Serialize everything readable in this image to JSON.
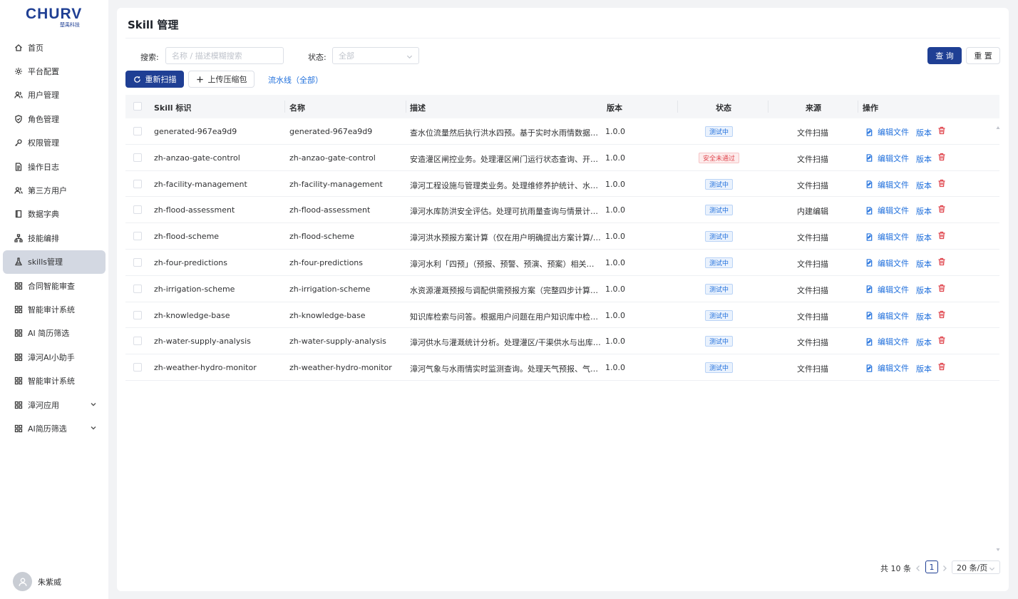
{
  "brand": {
    "logo_text": "CHURV",
    "logo_sub": "楚禹科技"
  },
  "sidebar": {
    "items": [
      {
        "label": "首页",
        "icon": "home-icon"
      },
      {
        "label": "平台配置",
        "icon": "gear-icon"
      },
      {
        "label": "用户管理",
        "icon": "users-icon"
      },
      {
        "label": "角色管理",
        "icon": "shield-icon"
      },
      {
        "label": "权限管理",
        "icon": "key-icon"
      },
      {
        "label": "操作日志",
        "icon": "document-icon"
      },
      {
        "label": "第三方用户",
        "icon": "users-icon"
      },
      {
        "label": "数据字典",
        "icon": "book-icon"
      },
      {
        "label": "技能编排",
        "icon": "flow-icon"
      },
      {
        "label": "skills管理",
        "icon": "flask-icon",
        "active": true
      },
      {
        "label": "合同智能审查",
        "icon": "grid-icon"
      },
      {
        "label": "智能审计系统",
        "icon": "grid-icon"
      },
      {
        "label": "AI 简历筛选",
        "icon": "grid-icon"
      },
      {
        "label": "漳河AI小助手",
        "icon": "grid-icon"
      },
      {
        "label": "智能审计系统",
        "icon": "grid-icon"
      },
      {
        "label": "漳河应用",
        "icon": "grid-icon",
        "expandable": true
      },
      {
        "label": "AI简历筛选",
        "icon": "grid-icon",
        "expandable": true
      }
    ]
  },
  "user": {
    "name": "朱紫威"
  },
  "main": {
    "title": "Skill 管理",
    "filters": {
      "search_label": "搜索:",
      "search_placeholder": "名称 / 描述模糊搜索",
      "status_label": "状态:",
      "status_value": "全部"
    },
    "buttons": {
      "query": "查 询",
      "reset": "重 置",
      "rescan": "重新扫描",
      "upload": "上传压缩包",
      "pipeline": "流水线（全部）"
    },
    "table": {
      "columns": [
        "Skill 标识",
        "名称",
        "描述",
        "版本",
        "状态",
        "来源",
        "操作"
      ],
      "actions": {
        "edit": "编辑文件",
        "version": "版本"
      },
      "rows": [
        {
          "id": "generated-967ea9d9",
          "name": "generated-967ea9d9",
          "desc": "查水位流量然后执行洪水四预。基于实时水雨情数据执行洪水四预分析",
          "version": "1.0.0",
          "status": "测试中",
          "status_type": "test",
          "source": "文件扫描"
        },
        {
          "id": "zh-anzao-gate-control",
          "name": "zh-anzao-gate-control",
          "desc": "安造灌区闸控业务。处理灌区闸门运行状态查询、开闸放水计划",
          "version": "1.0.0",
          "status": "安全未通过",
          "status_type": "fail",
          "source": "文件扫描"
        },
        {
          "id": "zh-facility-management",
          "name": "zh-facility-management",
          "desc": "漳河工程设施与管理类业务。处理维修养护统计、水费征收",
          "version": "1.0.0",
          "status": "测试中",
          "status_type": "test",
          "source": "文件扫描"
        },
        {
          "id": "zh-flood-assessment",
          "name": "zh-flood-assessment",
          "desc": "漳河水库防洪安全评估。处理可抗雨量查询与情景计算分析",
          "version": "1.0.0",
          "status": "测试中",
          "status_type": "test",
          "source": "内建编辑"
        },
        {
          "id": "zh-flood-scheme",
          "name": "zh-flood-scheme",
          "desc": "漳河洪水预报方案计算（仅在用户明确提出方案计算/调度时使用）",
          "version": "1.0.0",
          "status": "测试中",
          "status_type": "test",
          "source": "文件扫描"
        },
        {
          "id": "zh-four-predictions",
          "name": "zh-four-predictions",
          "desc": "漳河水利「四预」（预报、预警、预演、预案）相关业务处理",
          "version": "1.0.0",
          "status": "测试中",
          "status_type": "test",
          "source": "文件扫描"
        },
        {
          "id": "zh-irrigation-scheme",
          "name": "zh-irrigation-scheme",
          "desc": "水资源灌溉预报与调配供需预报方案（完整四步计算链路）",
          "version": "1.0.0",
          "status": "测试中",
          "status_type": "test",
          "source": "文件扫描"
        },
        {
          "id": "zh-knowledge-base",
          "name": "zh-knowledge-base",
          "desc": "知识库检索与问答。根据用户问题在用户知识库中检索相关内容",
          "version": "1.0.0",
          "status": "测试中",
          "status_type": "test",
          "source": "文件扫描"
        },
        {
          "id": "zh-water-supply-analysis",
          "name": "zh-water-supply-analysis",
          "desc": "漳河供水与灌溉统计分析。处理灌区/干渠供水与出库水量统计",
          "version": "1.0.0",
          "status": "测试中",
          "status_type": "test",
          "source": "文件扫描"
        },
        {
          "id": "zh-weather-hydro-monitor",
          "name": "zh-weather-hydro-monitor",
          "desc": "漳河气象与水雨情实时监测查询。处理天气预报、气象预警查询",
          "version": "1.0.0",
          "status": "测试中",
          "status_type": "test",
          "source": "文件扫描"
        }
      ]
    },
    "pagination": {
      "total": "共 10 条",
      "current_page": "1",
      "page_size": "20 条/页"
    }
  },
  "colors": {
    "primary": "#1f3f94",
    "link": "#1f6fdc",
    "danger": "#e0474f",
    "active_bg": "#d3d8e2"
  }
}
